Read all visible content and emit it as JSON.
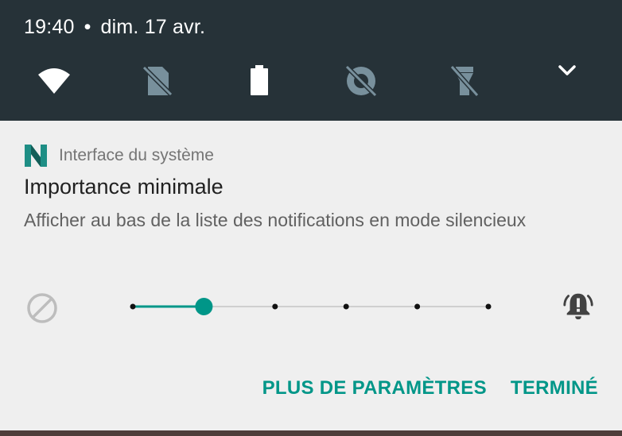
{
  "status_bar": {
    "time": "19:40",
    "separator": "•",
    "date": "dim. 17 avr."
  },
  "quick_settings": {
    "icons": [
      "wifi-icon",
      "no-sim-icon",
      "battery-full-icon",
      "data-saver-off-icon",
      "flashlight-off-icon"
    ],
    "expand_icon": "chevron-down-icon"
  },
  "notification": {
    "app_name": "Interface du système",
    "title": "Importance minimale",
    "description": "Afficher au bas de la liste des notifications en mode silencieux"
  },
  "importance_slider": {
    "levels": 6,
    "selected_level": 2,
    "min_icon": "block-icon",
    "max_icon": "alert-bell-icon",
    "accent_color": "#009688"
  },
  "actions": {
    "more_settings": "PLUS DE PARAMÈTRES",
    "done": "TERMINÉ"
  },
  "colors": {
    "header_bg": "#263238",
    "card_bg": "#efefef",
    "accent": "#009688"
  }
}
